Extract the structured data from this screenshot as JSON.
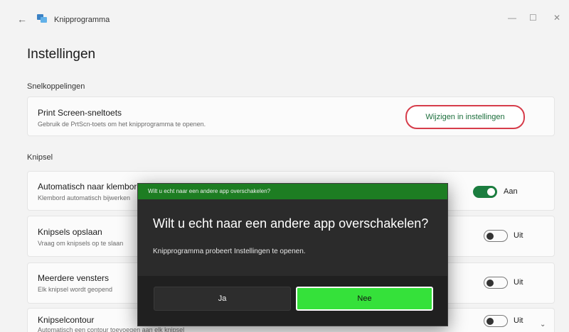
{
  "window": {
    "app_title": "Knipprogramma",
    "controls": {
      "minimize": "—",
      "maximize": "☐",
      "close": "✕"
    },
    "back_glyph": "←"
  },
  "page": {
    "title": "Instellingen"
  },
  "sections": {
    "shortcuts": {
      "title": "Snelkoppelingen",
      "items": [
        {
          "title": "Print Screen-sneltoets",
          "description": "Gebruik de PrtScn-toets om het knipprogramma te openen.",
          "action_label": "Wijzigen in instellingen"
        }
      ]
    },
    "snip": {
      "title": "Knipsel",
      "items": [
        {
          "title": "Automatisch naar klembord kopiëren",
          "description": "Klembord automatisch bijwerken",
          "toggle_on": true,
          "state_label": "Aan"
        },
        {
          "title": "Knipsels opslaan",
          "description": "Vraag om knipsels op te slaan",
          "toggle_on": false,
          "state_label": "Uit"
        },
        {
          "title": "Meerdere vensters",
          "description": "Elk knipsel wordt geopend",
          "toggle_on": false,
          "state_label": "Uit"
        },
        {
          "title": "Knipselcontour",
          "description": "Automatisch een contour toevoegen aan elk knipsel",
          "toggle_on": false,
          "state_label": "Uit",
          "has_chevron": true
        }
      ]
    }
  },
  "dialog": {
    "header": "Wilt u echt naar een andere app overschakelen?",
    "title": "Wilt u echt naar een andere app overschakelen?",
    "body": "Knipprogramma probeert Instellingen te openen.",
    "buttons": {
      "yes": "Ja",
      "no": "Nee"
    }
  },
  "colors": {
    "toggle_on": "#1b7d3f",
    "link_text": "#1b6e3b",
    "highlight_ring": "#d63c4a",
    "dialog_header": "#1d7d22",
    "dialog_primary": "#35e13a"
  }
}
